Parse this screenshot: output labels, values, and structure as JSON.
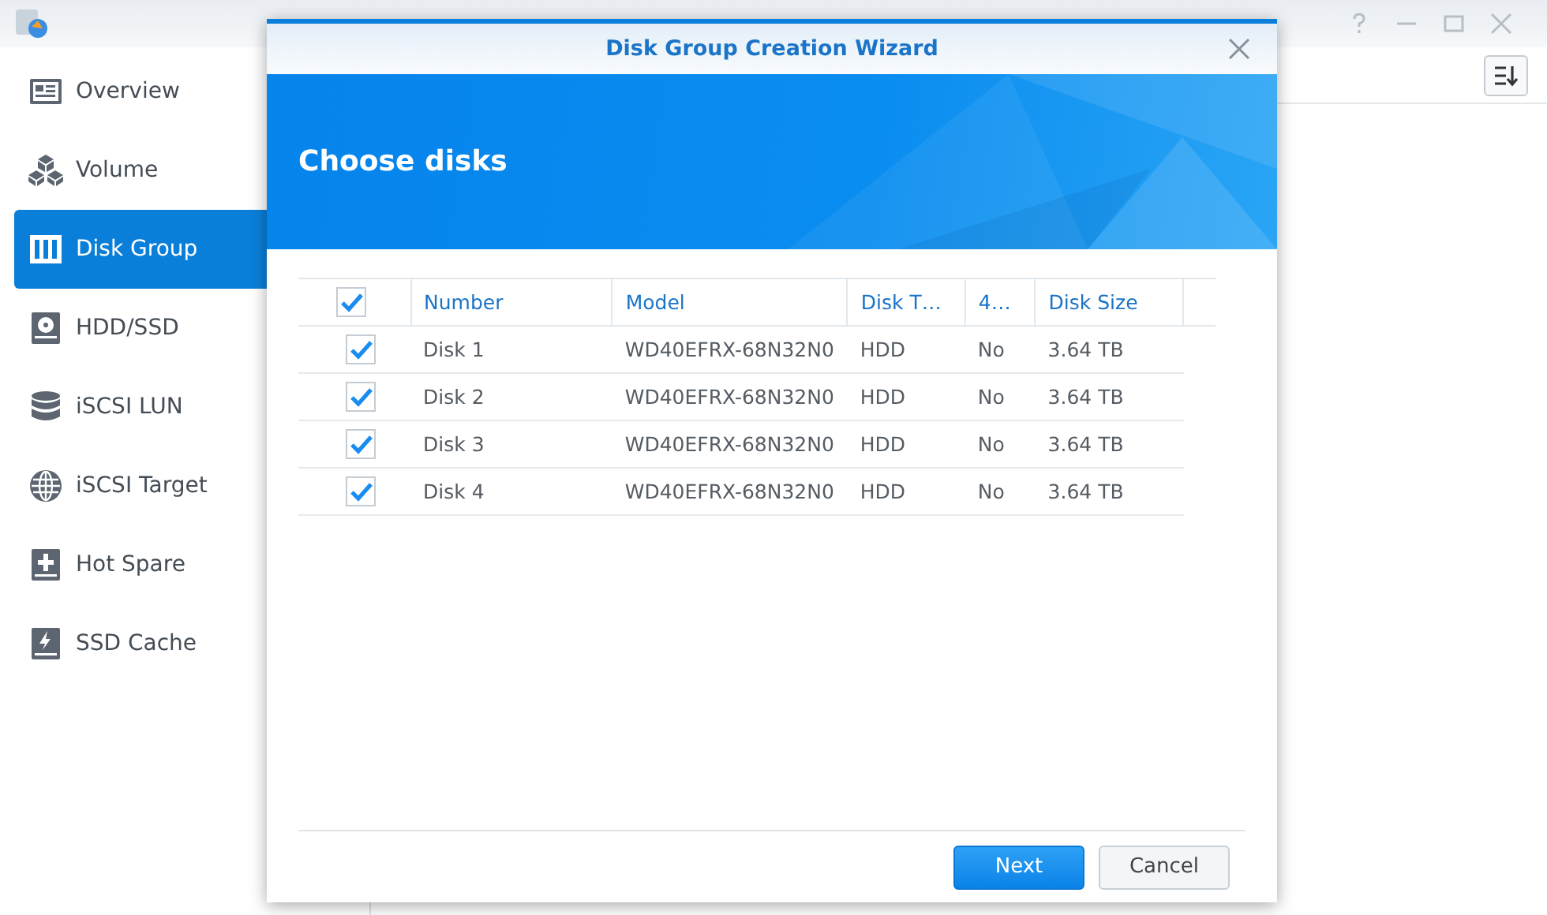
{
  "sidebar": {
    "items": [
      {
        "label": "Overview",
        "selected": false
      },
      {
        "label": "Volume",
        "selected": false
      },
      {
        "label": "Disk Group",
        "selected": true
      },
      {
        "label": "HDD/SSD",
        "selected": false
      },
      {
        "label": "iSCSI LUN",
        "selected": false
      },
      {
        "label": "iSCSI Target",
        "selected": false
      },
      {
        "label": "Hot Spare",
        "selected": false
      },
      {
        "label": "SSD Cache",
        "selected": false
      }
    ]
  },
  "dialog": {
    "title": "Disk Group Creation Wizard",
    "heading": "Choose disks",
    "table": {
      "all_checked": true,
      "columns": [
        "Number",
        "Model",
        "Disk T…",
        "4…",
        "Disk Size"
      ],
      "rows": [
        {
          "checked": true,
          "cells": [
            "Disk 1",
            "WD40EFRX-68N32N0",
            "HDD",
            "No",
            "3.64 TB"
          ]
        },
        {
          "checked": true,
          "cells": [
            "Disk 2",
            "WD40EFRX-68N32N0",
            "HDD",
            "No",
            "3.64 TB"
          ]
        },
        {
          "checked": true,
          "cells": [
            "Disk 3",
            "WD40EFRX-68N32N0",
            "HDD",
            "No",
            "3.64 TB"
          ]
        },
        {
          "checked": true,
          "cells": [
            "Disk 4",
            "WD40EFRX-68N32N0",
            "HDD",
            "No",
            "3.64 TB"
          ]
        }
      ]
    },
    "buttons": [
      {
        "label": "Next",
        "kind": "primary"
      },
      {
        "label": "Cancel",
        "kind": "secondary"
      }
    ]
  }
}
